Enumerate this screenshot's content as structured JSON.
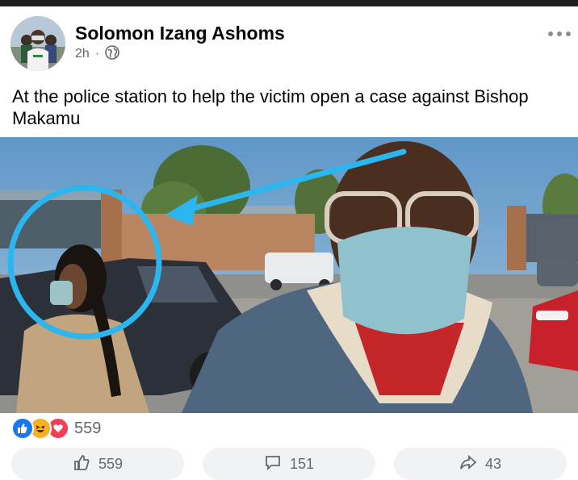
{
  "post": {
    "author": "Solomon Izang Ashoms",
    "time": "2h",
    "separator": "·",
    "caption": "At the police station to help the victim open a case against Bishop Makamu"
  },
  "reactions": {
    "count": "559",
    "types": [
      "like-icon",
      "haha-icon",
      "love-icon"
    ],
    "colors": {
      "like": "#1877f2",
      "haha": "#f7b125",
      "love": "#f33e58"
    }
  },
  "actions": [
    {
      "name": "like-action-button",
      "icon": "thumbs-up-icon",
      "label": "559"
    },
    {
      "name": "comment-action-button",
      "icon": "comment-icon",
      "label": "151"
    },
    {
      "name": "share-action-button",
      "icon": "share-icon",
      "label": "43"
    }
  ]
}
